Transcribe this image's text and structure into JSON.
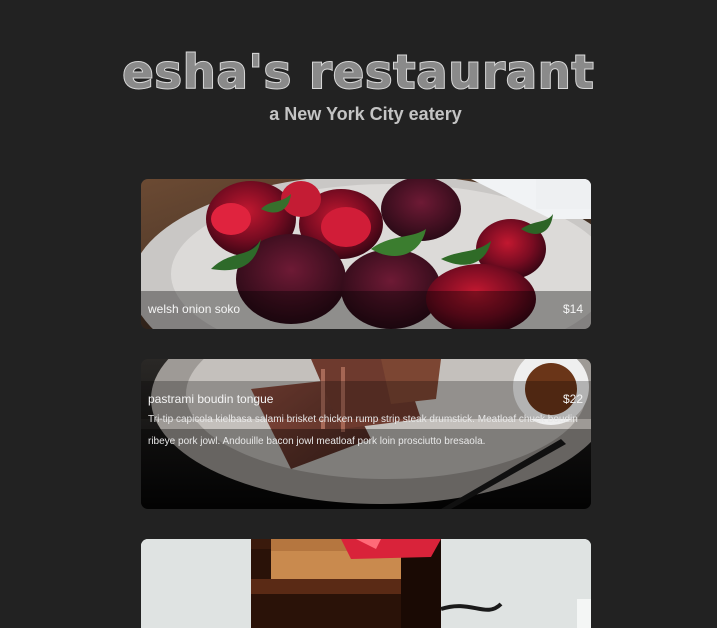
{
  "header": {
    "logo": "esha's restaurant",
    "subtitle": "a New York City eatery"
  },
  "menu": [
    {
      "name": "welsh onion soko",
      "price": "$14",
      "description": ""
    },
    {
      "name": "pastrami boudin tongue",
      "price": "$22",
      "description": "Tri-tip capicola kielbasa salami brisket chicken rump strip steak drumstick. Meatloaf chuck boudin ribeye pork jowl. Andouille bacon jowl meatloaf pork loin prosciutto bresaola."
    },
    {
      "name": "",
      "price": "",
      "description": ""
    }
  ]
}
